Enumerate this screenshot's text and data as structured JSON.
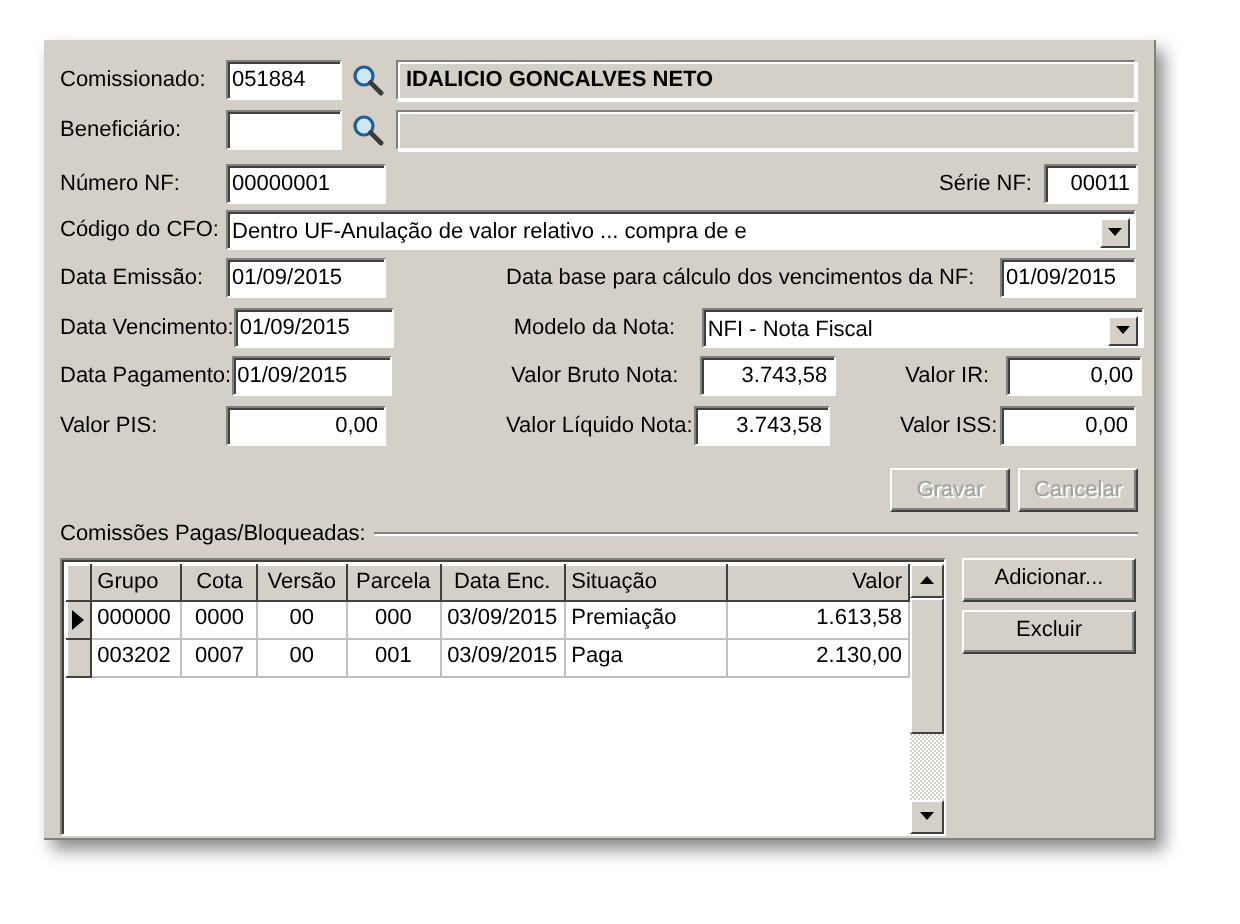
{
  "comissionado": {
    "label": "Comissionado:",
    "code": "051884",
    "name": "IDALICIO GONCALVES NETO"
  },
  "beneficiario": {
    "label": "Beneficiário:"
  },
  "numero_nf": {
    "label": "Número NF:",
    "value": "00000001"
  },
  "serie_nf": {
    "label": "Série NF:",
    "value": "00011"
  },
  "cfo": {
    "label": "Código do CFO:",
    "value": "Dentro UF-Anulação de valor relativo ... compra de e"
  },
  "data_emissao": {
    "label": "Data Emissão:",
    "value": "01/09/2015"
  },
  "data_base": {
    "label": "Data base para cálculo dos vencimentos da NF:",
    "value": "01/09/2015"
  },
  "data_vencimento": {
    "label": "Data Vencimento:",
    "value": "01/09/2015"
  },
  "modelo_nota": {
    "label": "Modelo da Nota:",
    "value": "NFI - Nota Fiscal"
  },
  "data_pagamento": {
    "label": "Data Pagamento:",
    "value": "01/09/2015"
  },
  "valor_bruto": {
    "label": "Valor Bruto Nota:",
    "value": "3.743,58"
  },
  "valor_ir": {
    "label": "Valor IR:",
    "value": "0,00"
  },
  "valor_pis": {
    "label": "Valor PIS:",
    "value": "0,00"
  },
  "valor_liquido": {
    "label": "Valor Líquido Nota:",
    "value": "3.743,58"
  },
  "valor_iss": {
    "label": "Valor ISS:",
    "value": "0,00"
  },
  "actions": [
    {
      "label": "Gravar",
      "disabled": true
    },
    {
      "label": "Cancelar",
      "disabled": true
    }
  ],
  "commissions": {
    "title": "Comissões Pagas/Bloqueadas:",
    "columns": [
      "Grupo",
      "Cota",
      "Versão",
      "Parcela",
      "Data Enc.",
      "Situação",
      "Valor"
    ],
    "rows": [
      {
        "selected": true,
        "cells": [
          "000000",
          "0000",
          "00",
          "000",
          "03/09/2015",
          "Premiação",
          "1.613,58"
        ]
      },
      {
        "selected": false,
        "cells": [
          "003202",
          "0007",
          "00",
          "001",
          "03/09/2015",
          "Paga",
          "2.130,00"
        ]
      }
    ]
  },
  "side_buttons": [
    {
      "label": "Adicionar..."
    },
    {
      "label": "Excluir"
    }
  ]
}
